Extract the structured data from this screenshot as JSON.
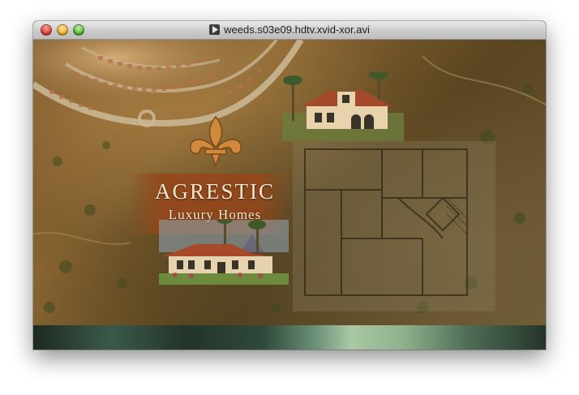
{
  "window": {
    "title": "weeds.s03e09.hdtv.xvid-xor.avi",
    "buttons": {
      "close": "close",
      "minimize": "minimize",
      "zoom": "zoom"
    },
    "icon": "video-file-icon"
  },
  "video_frame": {
    "logo": {
      "name": "AGRESTIC",
      "tagline": "Luxury Homes",
      "emblem": "fleur-de-lis-icon"
    },
    "colors": {
      "banner": "#963f19",
      "text": "#f4e6cf",
      "earth": "#6a4a22"
    }
  }
}
